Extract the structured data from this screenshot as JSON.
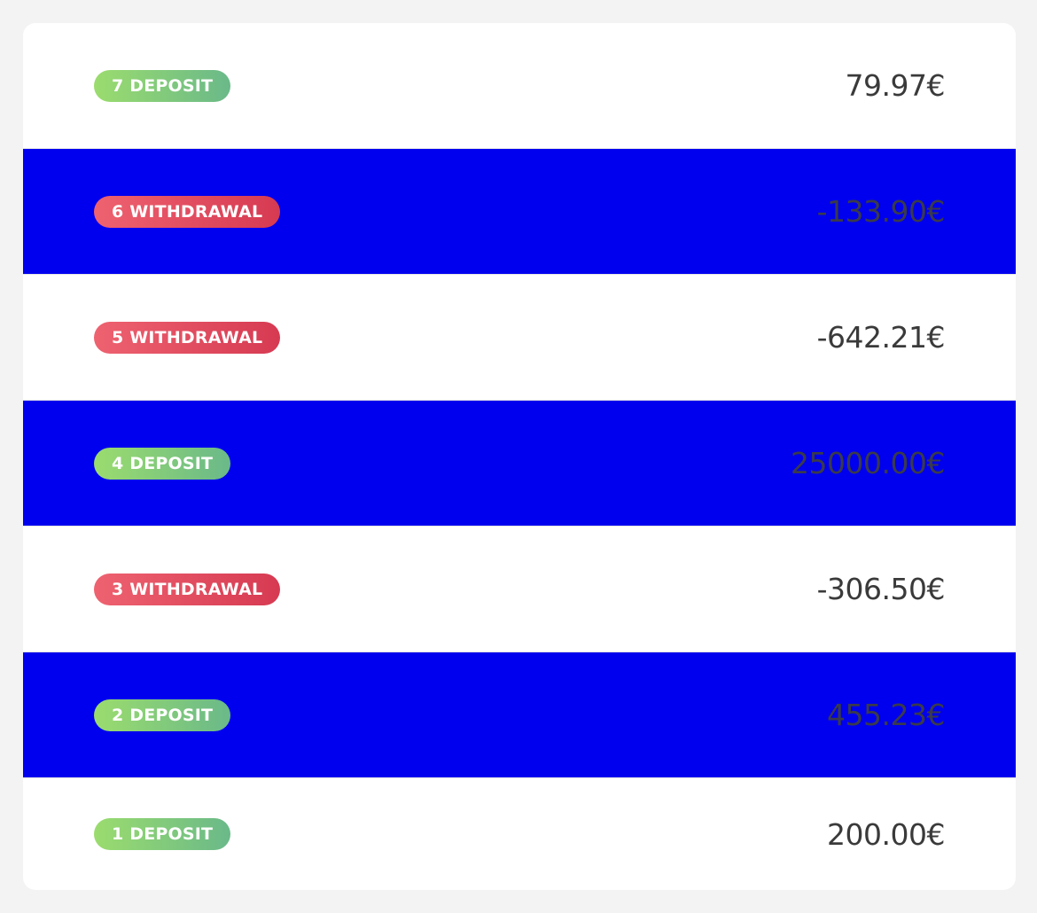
{
  "transactions": [
    {
      "badge": "7 DEPOSIT",
      "type": "deposit",
      "amount": "79.97€",
      "highlight": false
    },
    {
      "badge": "6 WITHDRAWAL",
      "type": "withdrawal",
      "amount": "-133.90€",
      "highlight": true
    },
    {
      "badge": "5 WITHDRAWAL",
      "type": "withdrawal",
      "amount": "-642.21€",
      "highlight": false
    },
    {
      "badge": "4 DEPOSIT",
      "type": "deposit",
      "amount": "25000.00€",
      "highlight": true
    },
    {
      "badge": "3 WITHDRAWAL",
      "type": "withdrawal",
      "amount": "-306.50€",
      "highlight": false
    },
    {
      "badge": "2 DEPOSIT",
      "type": "deposit",
      "amount": "455.23€",
      "highlight": true
    },
    {
      "badge": "1 DEPOSIT",
      "type": "deposit",
      "amount": "200.00€",
      "highlight": false
    }
  ],
  "colors": {
    "highlight_row": "#0000ee",
    "deposit_badge": "#86cd7a",
    "withdrawal_badge": "#e24d5f",
    "amount_text": "#3a3a3a",
    "page_background": "#f3f3f3"
  }
}
